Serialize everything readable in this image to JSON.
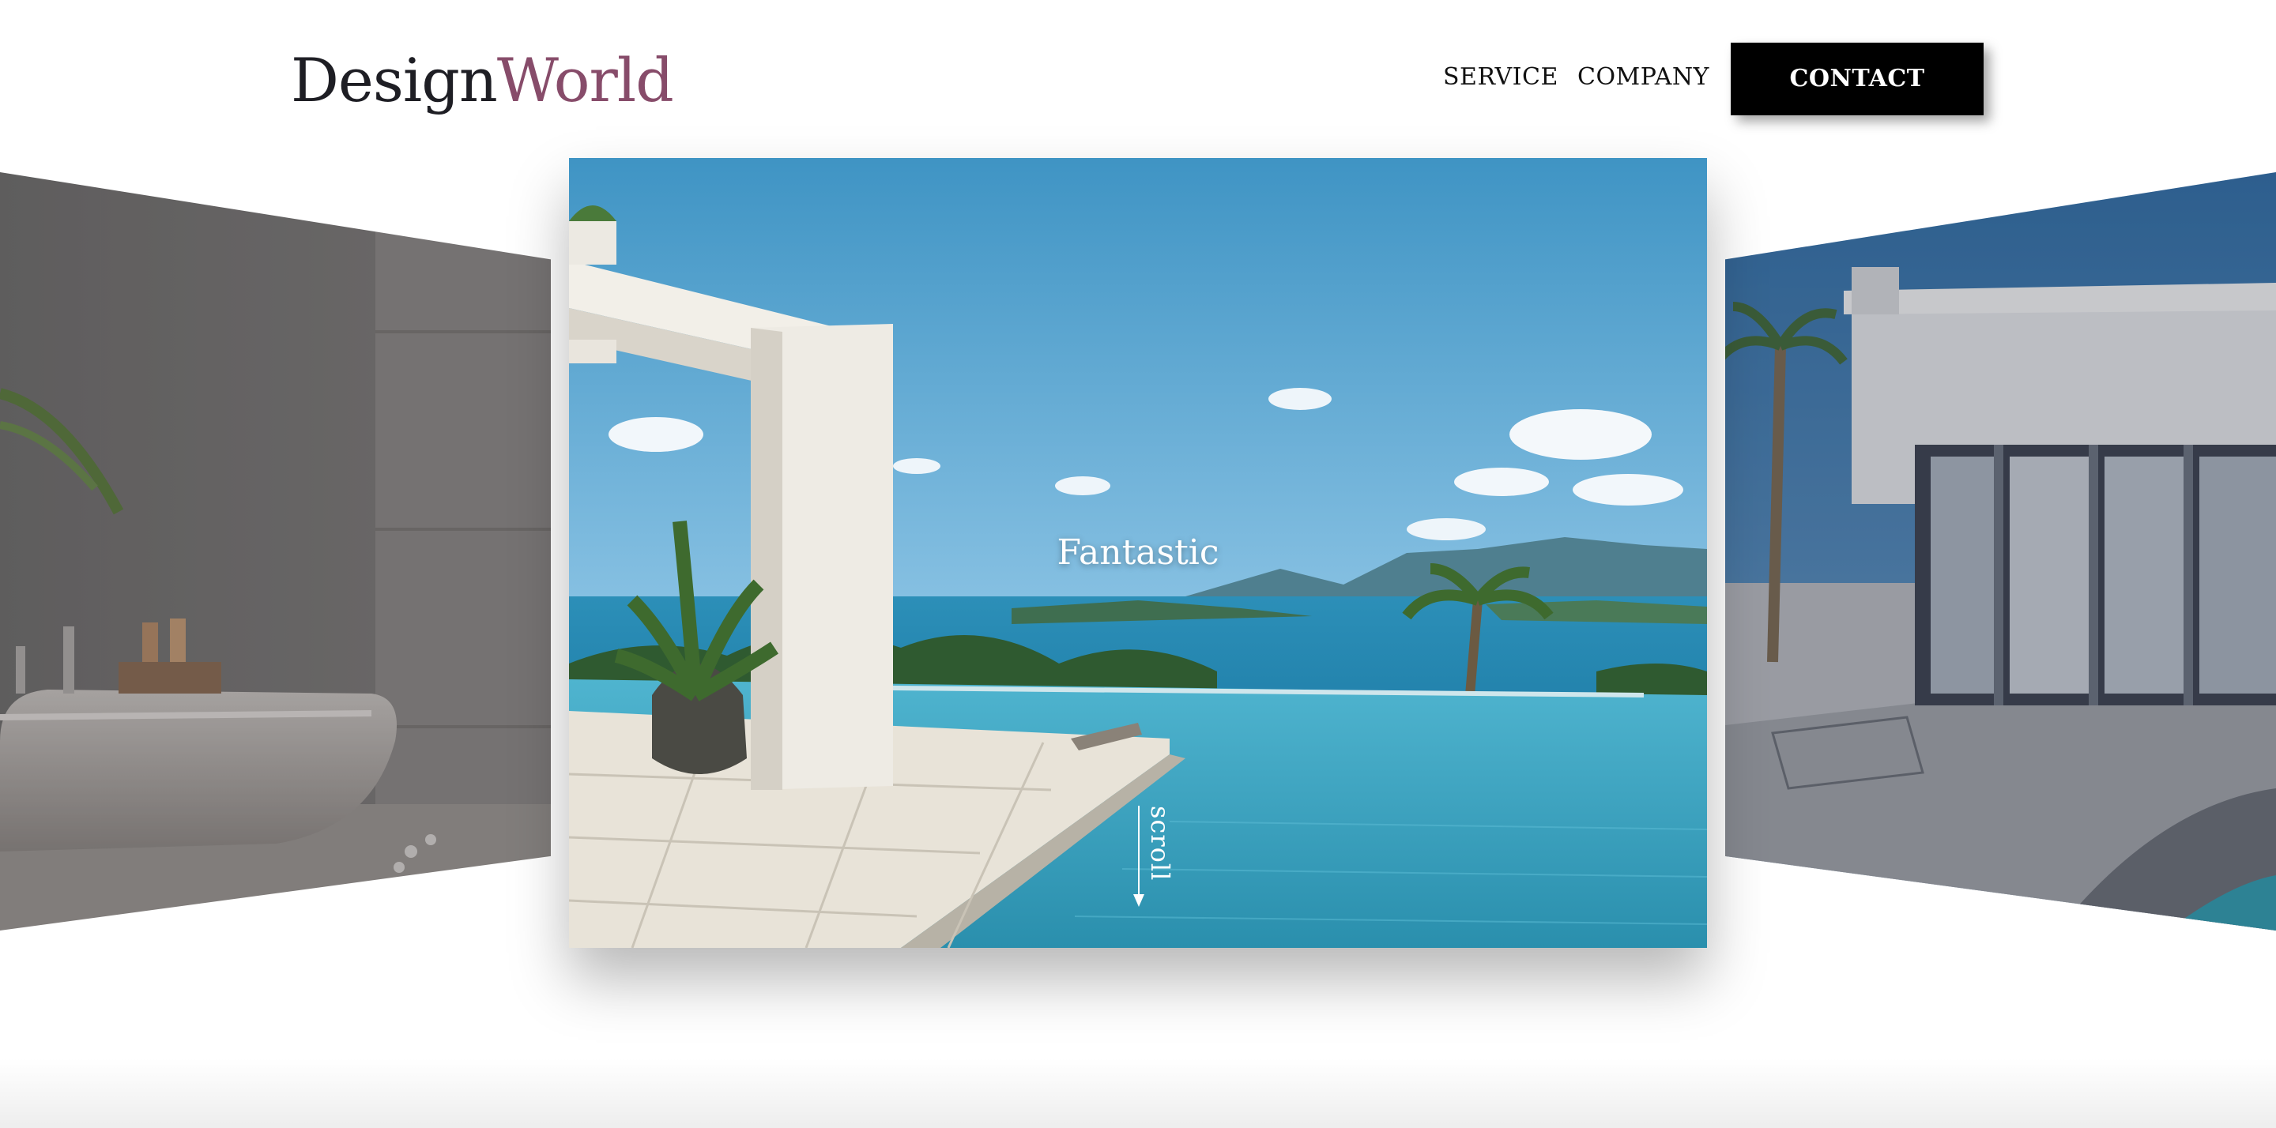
{
  "header": {
    "logo_part1": "Design",
    "logo_part2": "World",
    "nav": {
      "service": "SERVICE",
      "company": "COMPANY"
    },
    "contact_label": "CONTACT"
  },
  "hero": {
    "title": "Fantastic",
    "scroll_label": "scroll"
  },
  "colors": {
    "logo_accent": "#874c6a",
    "logo_dark": "#1e1e24",
    "button_bg": "#000000",
    "button_text": "#ffffff"
  },
  "icons": {
    "scroll": "arrow-down-icon"
  }
}
